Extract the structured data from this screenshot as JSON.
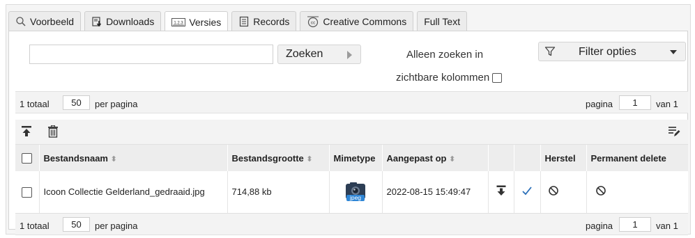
{
  "tabs": [
    {
      "label": "Voorbeeld",
      "icon": "magnifier-icon"
    },
    {
      "label": "Downloads",
      "icon": "downloads-icon"
    },
    {
      "label": "Versies",
      "icon": "versions-icon"
    },
    {
      "label": "Records",
      "icon": "records-icon"
    },
    {
      "label": "Creative Commons",
      "icon": "creative-commons-icon"
    },
    {
      "label": "Full Text",
      "icon": ""
    }
  ],
  "active_tab": "Versies",
  "search": {
    "value": "",
    "button_label": "Zoeken",
    "only_visible_line1": "Alleen zoeken in",
    "only_visible_line2": "zichtbare kolommen",
    "only_visible_checked": false
  },
  "filter": {
    "label": "Filter opties"
  },
  "pager_top": {
    "total_text": "1 totaal",
    "per_page_value": "50",
    "per_page_text": "per pagina",
    "page_label": "pagina",
    "page_value": "1",
    "of_text": "van 1"
  },
  "pager_bottom": {
    "total_text": "1 totaal",
    "per_page_value": "50",
    "per_page_text": "per pagina",
    "page_label": "pagina",
    "page_value": "1",
    "of_text": "van 1"
  },
  "toolbar": {
    "upload_icon": "upload-icon",
    "delete_icon": "trash-icon",
    "edit_columns_icon": "edit-columns-icon"
  },
  "table": {
    "headers": {
      "filename": "Bestandsnaam",
      "filesize": "Bestandsgrootte",
      "mimetype": "Mimetype",
      "modified": "Aangepast op",
      "restore": "Herstel",
      "permanent_delete": "Permanent delete"
    },
    "rows": [
      {
        "filename": "Icoon Collectie Gelderland_gedraaid.jpg",
        "filesize": "714,88 kb",
        "mimetype_icon_text": "jpeg",
        "modified": "2022-08-15 15:49:47",
        "checked": false
      }
    ]
  },
  "colors": {
    "accent_blue": "#2a6fb8",
    "tab_border": "#cfcfcf",
    "header_bg": "#ededed"
  }
}
